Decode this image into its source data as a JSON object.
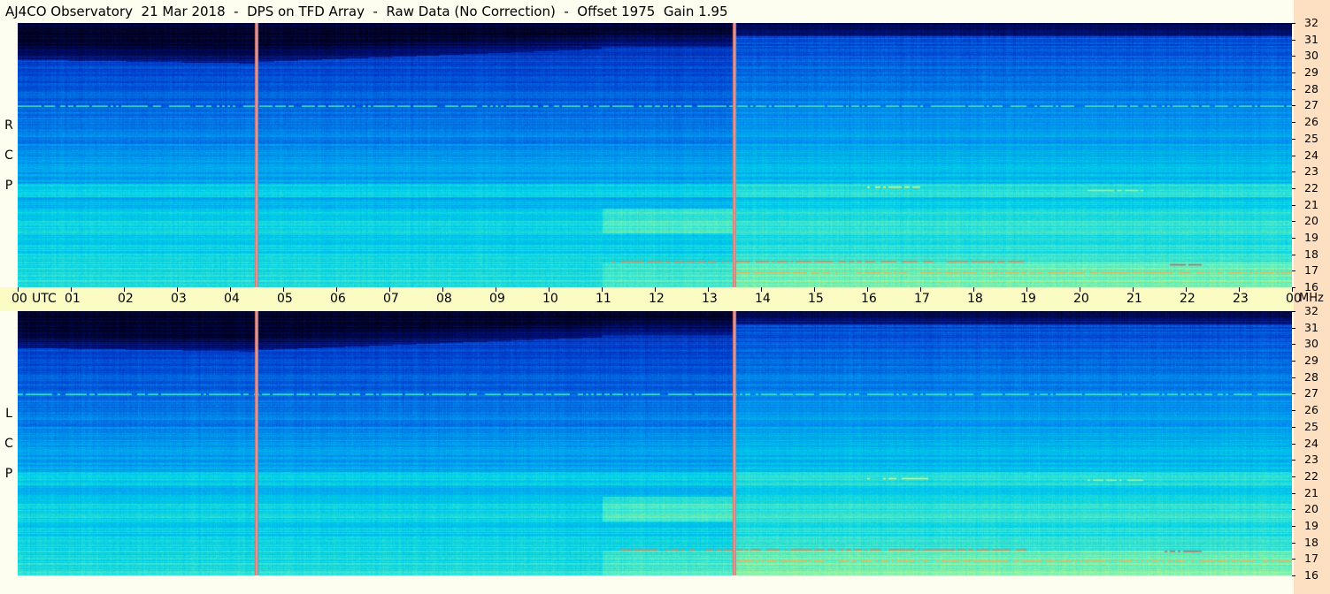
{
  "title": "AJ4CO Observatory  21 Mar 2018  -  DPS on TFD Array  -  Raw Data (No Correction)  -  Offset 1975  Gain 1.95",
  "colors": {
    "background": "#fdfdf0",
    "time_axis_bg": "#fbfbc4",
    "freq_axis_bg": "#fde0c2",
    "colormap": [
      "#000018",
      "#00107a",
      "#0040d0",
      "#0090f0",
      "#00d0e8",
      "#60f0c0",
      "#f0f060",
      "#f06040",
      "#e040c0"
    ]
  },
  "chart_data": [
    {
      "type": "heatmap",
      "name": "RCP",
      "polarization_label": [
        "R",
        "C",
        "P"
      ],
      "x_unit": "UTC",
      "x_ticks": [
        "00",
        "01",
        "02",
        "03",
        "04",
        "05",
        "06",
        "07",
        "08",
        "09",
        "10",
        "11",
        "12",
        "13",
        "14",
        "15",
        "16",
        "17",
        "18",
        "19",
        "20",
        "21",
        "22",
        "23",
        "00"
      ],
      "x_range_hours": [
        0,
        24
      ],
      "y_unit": "MHz",
      "y_ticks": [
        "32",
        "31",
        "30",
        "29",
        "28",
        "27",
        "26",
        "25",
        "24",
        "23",
        "22",
        "21",
        "20",
        "19",
        "18",
        "17",
        "16"
      ],
      "y_range_mhz": [
        16,
        32
      ],
      "vertical_lines_hours": [
        4.5,
        13.5
      ],
      "interference_lines": [
        {
          "freq": 17.6,
          "t_start": 11.2,
          "t_end": 19.0,
          "level": 0.85
        },
        {
          "freq": 16.9,
          "t_start": 13.5,
          "t_end": 24.0,
          "level": 0.8
        },
        {
          "freq": 27.0,
          "t_start": 0.0,
          "t_end": 24.0,
          "level": 0.6
        },
        {
          "freq": 22.1,
          "t_start": 16.0,
          "t_end": 17.0,
          "level": 0.75
        },
        {
          "freq": 21.9,
          "t_start": 20.1,
          "t_end": 21.2,
          "level": 0.7
        },
        {
          "freq": 17.4,
          "t_start": 21.7,
          "t_end": 22.3,
          "level": 0.9
        }
      ]
    },
    {
      "type": "heatmap",
      "name": "LCP",
      "polarization_label": [
        "L",
        "C",
        "P"
      ],
      "x_unit": "UTC",
      "x_range_hours": [
        0,
        24
      ],
      "y_unit": "MHz",
      "y_ticks": [
        "32",
        "31",
        "30",
        "29",
        "28",
        "27",
        "26",
        "25",
        "24",
        "23",
        "22",
        "21",
        "20",
        "19",
        "18",
        "17",
        "16"
      ],
      "y_range_mhz": [
        16,
        32
      ],
      "vertical_lines_hours": [
        4.5,
        13.5
      ],
      "interference_lines": [
        {
          "freq": 17.6,
          "t_start": 11.3,
          "t_end": 19.0,
          "level": 0.85
        },
        {
          "freq": 16.9,
          "t_start": 13.5,
          "t_end": 24.0,
          "level": 0.8
        },
        {
          "freq": 27.0,
          "t_start": 0.0,
          "t_end": 24.0,
          "level": 0.6
        },
        {
          "freq": 21.9,
          "t_start": 16.0,
          "t_end": 17.2,
          "level": 0.75
        },
        {
          "freq": 21.8,
          "t_start": 20.0,
          "t_end": 21.2,
          "level": 0.7
        },
        {
          "freq": 17.5,
          "t_start": 21.6,
          "t_end": 22.3,
          "level": 0.9
        }
      ]
    }
  ]
}
